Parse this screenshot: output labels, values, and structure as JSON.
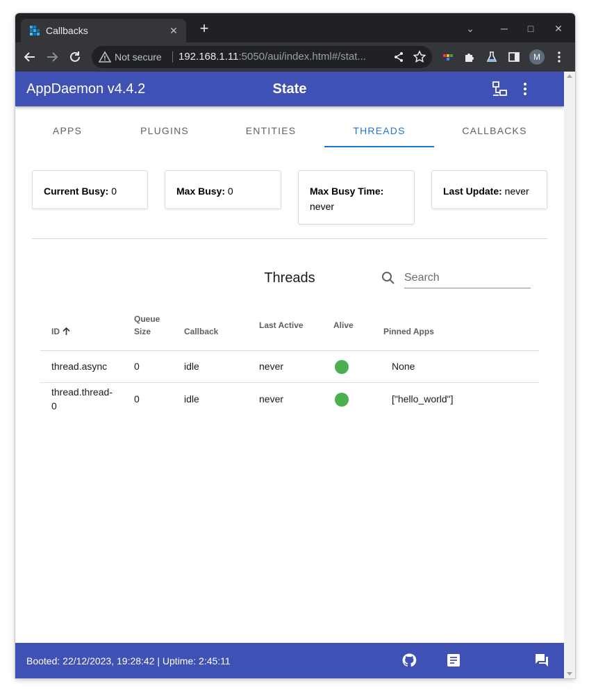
{
  "browser": {
    "tab_title": "Callbacks",
    "tab_close": "✕",
    "new_tab": "+",
    "not_secure": "Not secure",
    "url_host": "192.168.1.11",
    "url_rest": ":5050/aui/index.html#/stat...",
    "avatar_letter": "M",
    "minimize": "─",
    "maximize": "□",
    "close": "✕",
    "chevron": "⌄"
  },
  "app": {
    "title": "AppDaemon v4.4.2",
    "page_title": "State"
  },
  "nav_tabs": [
    {
      "label": "APPS"
    },
    {
      "label": "PLUGINS"
    },
    {
      "label": "ENTITIES"
    },
    {
      "label": "THREADS"
    },
    {
      "label": "CALLBACKS"
    }
  ],
  "cards": {
    "current_busy_label": "Current Busy:",
    "current_busy_value": " 0",
    "max_busy_label": "Max Busy:",
    "max_busy_value": " 0",
    "max_busy_time_label": "Max Busy Time:",
    "max_busy_time_value": "never",
    "last_update_label": "Last Update:",
    "last_update_value": " never"
  },
  "threads": {
    "title": "Threads",
    "search_placeholder": "Search",
    "columns": {
      "id": "ID",
      "queue_size_1": "Queue",
      "queue_size_2": "Size",
      "callback": "Callback",
      "last_active": "Last Active",
      "alive": "Alive",
      "pinned_apps": "Pinned Apps"
    },
    "rows": [
      {
        "id_line1": "thread.async",
        "id_line2": "",
        "queue_size": "0",
        "callback": "idle",
        "last_active": "never",
        "pinned_apps": "None"
      },
      {
        "id_line1": "thread.thread-",
        "id_line2": "0",
        "queue_size": "0",
        "callback": "idle",
        "last_active": "never",
        "pinned_apps": "[\"hello_world\"]"
      }
    ],
    "alive_color": "#4caf50"
  },
  "footer": {
    "text": "Booted: 22/12/2023, 19:28:42 | Uptime: 2:45:11"
  },
  "colors": {
    "primary": "#3f51b5",
    "accent": "#1976d2"
  }
}
